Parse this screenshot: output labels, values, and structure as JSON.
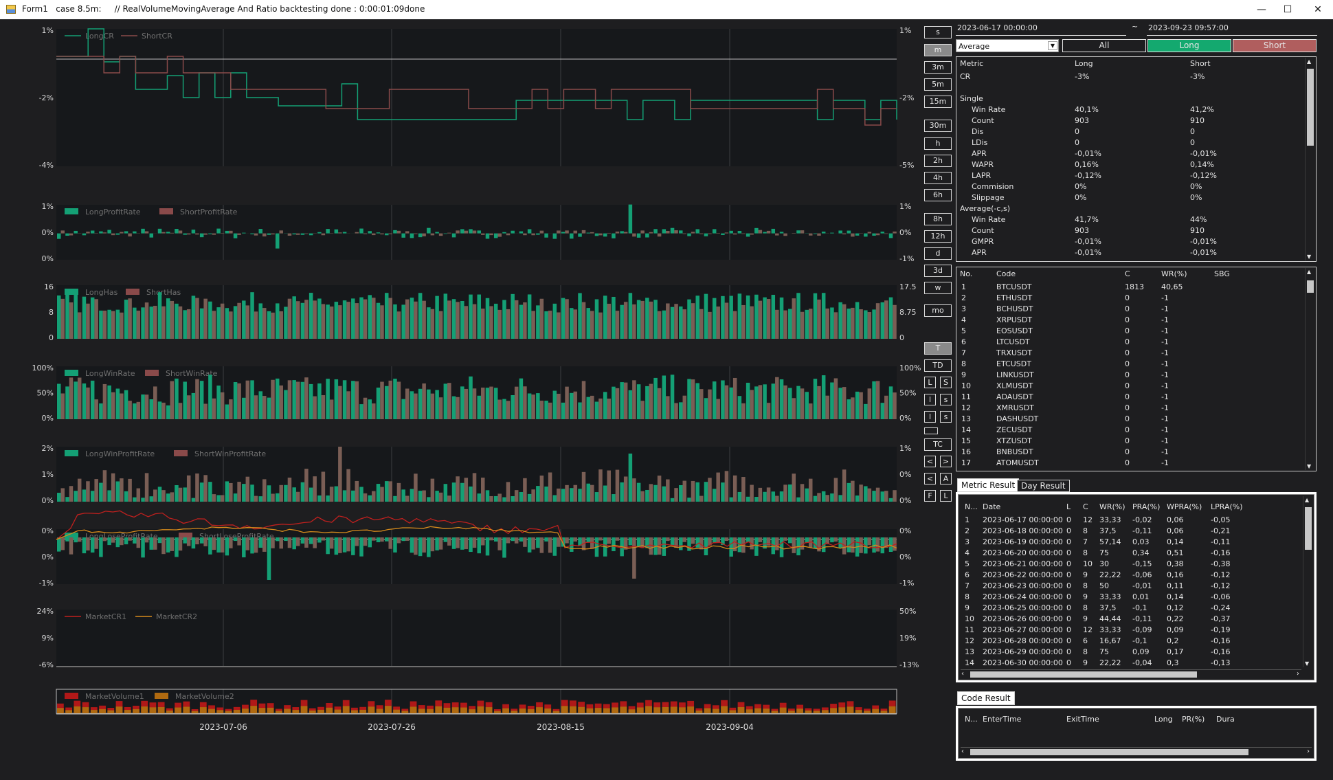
{
  "window": {
    "title": "Form1   case 8.5m:     // RealVolumeMovingAverage And Ratio backtesting done : 0:00:01:09done",
    "minimize": "—",
    "maximize": "☐",
    "close": "✕"
  },
  "colors": {
    "long": "#14a075",
    "short": "#8a4a4a",
    "shortBar": "#7a5e55",
    "marketCR1": "#c0201e",
    "marketCR2": "#d58a1c",
    "vol1": "#b01818",
    "vol2": "#b06a10",
    "bg": "#1e1e20",
    "chartbg": "#16181b"
  },
  "timeframes": [
    "s",
    "m",
    "3m",
    "5m",
    "15m",
    "30m",
    "h",
    "2h",
    "4h",
    "6h",
    "8h",
    "12h",
    "d",
    "3d",
    "w",
    "mo"
  ],
  "active_timeframe": "m",
  "tools": {
    "t": "T",
    "td": "TD",
    "tc": "TC",
    "pairs": [
      [
        "L",
        "S"
      ],
      [
        "l",
        "s"
      ],
      [
        "l",
        "s"
      ]
    ],
    "nav": [
      [
        "<",
        ">"
      ],
      [
        "<",
        "A"
      ],
      [
        "F",
        "L"
      ]
    ]
  },
  "date_range": {
    "start": "2023-06-17 00:00:00",
    "sep": "~",
    "end": "2023-09-23 09:57:00"
  },
  "filter": {
    "mode": "Average",
    "all": "All",
    "long": "Long",
    "short": "Short"
  },
  "metrics": {
    "headers": [
      "Metric",
      "Long",
      "Short"
    ],
    "rows": [
      {
        "label": "CR",
        "indent": 0,
        "long": "-3%",
        "short": "-3%"
      },
      {
        "label": "",
        "indent": 0,
        "long": "",
        "short": ""
      },
      {
        "label": "Single",
        "indent": 0,
        "long": "",
        "short": ""
      },
      {
        "label": "Win Rate",
        "indent": 1,
        "long": "40,1%",
        "short": "41,2%"
      },
      {
        "label": "Count",
        "indent": 1,
        "long": "903",
        "short": "910"
      },
      {
        "label": "Dis",
        "indent": 1,
        "long": "0",
        "short": "0"
      },
      {
        "label": "LDis",
        "indent": 1,
        "long": "0",
        "short": "0"
      },
      {
        "label": "APR",
        "indent": 1,
        "long": "-0,01%",
        "short": "-0,01%"
      },
      {
        "label": "WAPR",
        "indent": 1,
        "long": "0,16%",
        "short": "0,14%"
      },
      {
        "label": "LAPR",
        "indent": 1,
        "long": "-0,12%",
        "short": "-0,12%"
      },
      {
        "label": "Commision",
        "indent": 1,
        "long": "0%",
        "short": "0%"
      },
      {
        "label": "Slippage",
        "indent": 1,
        "long": "0%",
        "short": "0%"
      },
      {
        "label": "Average(-c,s)",
        "indent": 0,
        "long": "",
        "short": ""
      },
      {
        "label": "Win Rate",
        "indent": 1,
        "long": "41,7%",
        "short": "44%"
      },
      {
        "label": "Count",
        "indent": 1,
        "long": "903",
        "short": "910"
      },
      {
        "label": "GMPR",
        "indent": 1,
        "long": "-0,01%",
        "short": "-0,01%"
      },
      {
        "label": "APR",
        "indent": 1,
        "long": "-0,01%",
        "short": "-0,01%"
      }
    ]
  },
  "codes": {
    "headers": [
      "No.",
      "Code",
      "C",
      "WR(%)",
      "SBG"
    ],
    "rows": [
      [
        "1",
        "BTCUSDT",
        "1813",
        "40,65"
      ],
      [
        "2",
        "ETHUSDT",
        "0",
        "-1"
      ],
      [
        "3",
        "BCHUSDT",
        "0",
        "-1"
      ],
      [
        "4",
        "XRPUSDT",
        "0",
        "-1"
      ],
      [
        "5",
        "EOSUSDT",
        "0",
        "-1"
      ],
      [
        "6",
        "LTCUSDT",
        "0",
        "-1"
      ],
      [
        "7",
        "TRXUSDT",
        "0",
        "-1"
      ],
      [
        "8",
        "ETCUSDT",
        "0",
        "-1"
      ],
      [
        "9",
        "LINKUSDT",
        "0",
        "-1"
      ],
      [
        "10",
        "XLMUSDT",
        "0",
        "-1"
      ],
      [
        "11",
        "ADAUSDT",
        "0",
        "-1"
      ],
      [
        "12",
        "XMRUSDT",
        "0",
        "-1"
      ],
      [
        "13",
        "DASHUSDT",
        "0",
        "-1"
      ],
      [
        "14",
        "ZECUSDT",
        "0",
        "-1"
      ],
      [
        "15",
        "XTZUSDT",
        "0",
        "-1"
      ],
      [
        "16",
        "BNBUSDT",
        "0",
        "-1"
      ],
      [
        "17",
        "ATOMUSDT",
        "0",
        "-1"
      ]
    ]
  },
  "result_tabs": {
    "metric": "Metric Result",
    "day": "Day Result",
    "code": "Code Result"
  },
  "day_result": {
    "headers": [
      "N...",
      "Date",
      "L",
      "C",
      "WR(%)",
      "PRA(%)",
      "WPRA(%)",
      "LPRA(%)"
    ],
    "rows": [
      [
        "1",
        "2023-06-17 00:00:00",
        "0",
        "12",
        "33,33",
        "-0,02",
        "0,06",
        "-0,05"
      ],
      [
        "2",
        "2023-06-18 00:00:00",
        "0",
        "8",
        "37,5",
        "-0,11",
        "0,06",
        "-0,21"
      ],
      [
        "3",
        "2023-06-19 00:00:00",
        "0",
        "7",
        "57,14",
        "0,03",
        "0,14",
        "-0,11"
      ],
      [
        "4",
        "2023-06-20 00:00:00",
        "0",
        "8",
        "75",
        "0,34",
        "0,51",
        "-0,16"
      ],
      [
        "5",
        "2023-06-21 00:00:00",
        "0",
        "10",
        "30",
        "-0,15",
        "0,38",
        "-0,38"
      ],
      [
        "6",
        "2023-06-22 00:00:00",
        "0",
        "9",
        "22,22",
        "-0,06",
        "0,16",
        "-0,12"
      ],
      [
        "7",
        "2023-06-23 00:00:00",
        "0",
        "8",
        "50",
        "-0,01",
        "0,11",
        "-0,12"
      ],
      [
        "8",
        "2023-06-24 00:00:00",
        "0",
        "9",
        "33,33",
        "0,01",
        "0,14",
        "-0,06"
      ],
      [
        "9",
        "2023-06-25 00:00:00",
        "0",
        "8",
        "37,5",
        "-0,1",
        "0,12",
        "-0,24"
      ],
      [
        "10",
        "2023-06-26 00:00:00",
        "0",
        "9",
        "44,44",
        "-0,11",
        "0,22",
        "-0,37"
      ],
      [
        "11",
        "2023-06-27 00:00:00",
        "0",
        "12",
        "33,33",
        "-0,09",
        "0,09",
        "-0,19"
      ],
      [
        "12",
        "2023-06-28 00:00:00",
        "0",
        "6",
        "16,67",
        "-0,1",
        "0,2",
        "-0,16"
      ],
      [
        "13",
        "2023-06-29 00:00:00",
        "0",
        "8",
        "75",
        "0,09",
        "0,17",
        "-0,16"
      ],
      [
        "14",
        "2023-06-30 00:00:00",
        "0",
        "9",
        "22,22",
        "-0,04",
        "0,3",
        "-0,13"
      ]
    ]
  },
  "code_result": {
    "headers": [
      "N...",
      "EnterTime",
      "ExitTime",
      "Long",
      "PR(%)",
      "Dura"
    ]
  },
  "chart_data": [
    {
      "type": "line",
      "name": "cr",
      "legend": [
        "LongCR",
        "ShortCR"
      ],
      "yticks_left": [
        "1%",
        "-2%",
        "-4%"
      ],
      "yticks_right": [
        "1%",
        "-2%",
        "-5%"
      ],
      "series": [
        {
          "name": "LongCR",
          "values": [
            0,
            0,
            1,
            -0.2,
            0,
            -1.2,
            -1.2,
            -0.7,
            -1.5,
            -0.6,
            -1.5,
            -0.6,
            -1.5,
            -1.5,
            -1.8,
            -1.8,
            -1.8,
            -1.8,
            -1.0,
            -2.3,
            -2.3,
            -2.3,
            -2.3,
            -2.3,
            -2.3,
            -2.3,
            -2.3,
            -2.3,
            -2.3,
            -1.6,
            -1.6,
            -1.6,
            -1.6,
            -1.6,
            -1.6,
            -1.6,
            -2.3,
            -1.6,
            -1.6,
            -2.3,
            -1.6,
            -1.6,
            -1.6,
            -1.6,
            -1.6,
            -1.6,
            -1.6,
            -1.6,
            -2.3,
            -1.6,
            -1.6,
            -2.3,
            -1.6,
            -2.3
          ]
        },
        {
          "name": "ShortCR",
          "values": [
            0,
            0,
            0,
            -0.6,
            0,
            -0.6,
            -0.6,
            0,
            -0.6,
            -0.6,
            -0.6,
            -1.2,
            -1.2,
            -1.2,
            -1.2,
            -1.2,
            -1.2,
            -1.9,
            -1.9,
            -1.9,
            -1.9,
            -1.2,
            -1.2,
            -1.2,
            -1.2,
            -1.2,
            -1.9,
            -1.9,
            -1.9,
            -1.9,
            -1.2,
            -1.9,
            -1.2,
            -1.2,
            -1.9,
            -1.2,
            -1.2,
            -1.2,
            -1.2,
            -1.2,
            -1.9,
            -1.9,
            -1.9,
            -1.9,
            -1.9,
            -1.9,
            -1.9,
            -1.9,
            -1.2,
            -1.9,
            -1.9,
            -2.5,
            -1.9,
            -1.9
          ]
        }
      ]
    },
    {
      "type": "bar",
      "name": "profit",
      "legend": [
        "LongProfitRate",
        "ShortProfitRate"
      ],
      "yticks_left": [
        "1%",
        "0%",
        "0%"
      ],
      "yticks_right": [
        "1%",
        "0%",
        "-1%"
      ]
    },
    {
      "type": "bar",
      "name": "has",
      "legend": [
        "LongHas",
        "ShortHas"
      ],
      "yticks_left": [
        "16",
        "8",
        "0"
      ],
      "yticks_right": [
        "17.5",
        "8.75",
        "0"
      ]
    },
    {
      "type": "bar",
      "name": "winrate",
      "legend": [
        "LongWinRate",
        "ShortWinRate"
      ],
      "yticks_left": [
        "100%",
        "50%",
        "0%"
      ],
      "yticks_right": [
        "100%",
        "50%",
        "0%"
      ]
    },
    {
      "type": "bar",
      "name": "winprofit",
      "legend": [
        "LongWinProfitRate",
        "ShortWinProfitRate"
      ],
      "yticks_left": [
        "2%",
        "1%",
        "0%"
      ],
      "yticks_right": [
        "1%",
        "0%",
        "0%"
      ]
    },
    {
      "type": "bar",
      "name": "loseprofit",
      "legend": [
        "LongLoseProfitRate",
        "ShortLoseProfitRate"
      ],
      "yticks_left": [
        "0%",
        "0%",
        "-1%"
      ],
      "yticks_right": [
        "0%",
        "0%",
        "-1%"
      ]
    },
    {
      "type": "line",
      "name": "market",
      "legend": [
        "MarketCR1",
        "MarketCR2"
      ],
      "yticks_left": [
        "24%",
        "9%",
        "-6%"
      ],
      "yticks_right": [
        "50%",
        "19%",
        "-13%"
      ]
    },
    {
      "type": "bar",
      "name": "volume",
      "legend": [
        "MarketVolume1",
        "MarketVolume2"
      ],
      "yticks_left": [],
      "yticks_right": []
    }
  ],
  "xaxis_labels": [
    "2023-07-06",
    "2023-07-26",
    "2023-08-15",
    "2023-09-04"
  ]
}
